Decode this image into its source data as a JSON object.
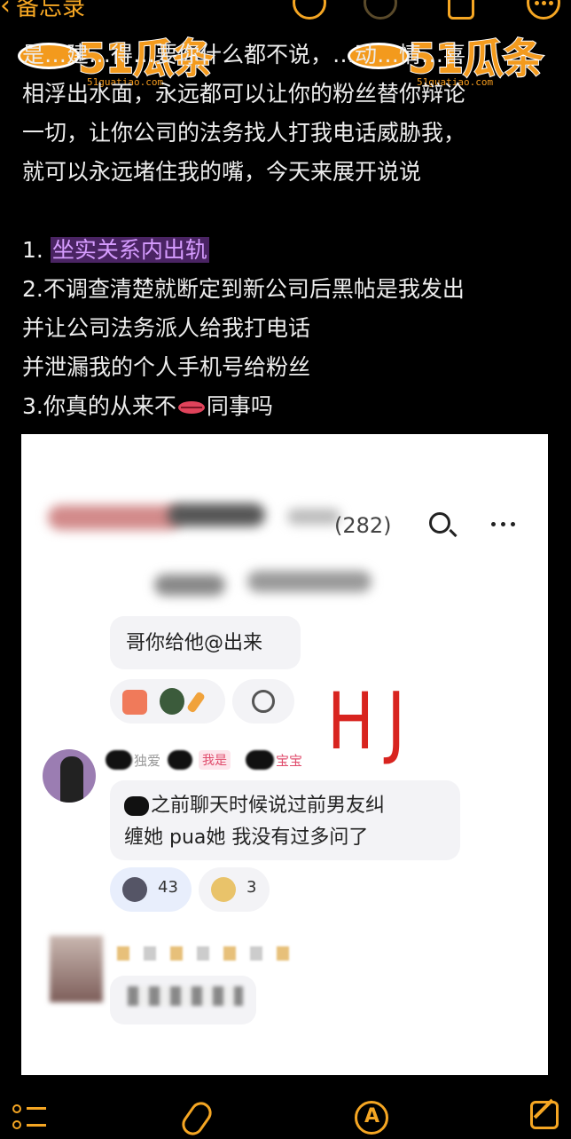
{
  "topbar": {
    "back_label": "备忘录"
  },
  "watermark": {
    "logo_text": "51瓜条",
    "url_text": "51guatiao.com"
  },
  "note": {
    "lines": [
      "是…建…得…要你什么都不说，…动…情…喜",
      "相浮出水面，永远都可以让你的粉丝替你辩论",
      "一切，让你公司的法务找人打我电话威胁我，",
      "就可以永远堵住我的嘴，今天来展开说说"
    ],
    "item1_number": "1.",
    "item1_highlight": "坐实关系内出轨",
    "item2_line1": "2.不调查清楚就断定到新公司后黑帖是我发出",
    "item2_line2": "并让公司法务派人给我打电话",
    "item2_line3": "并泄漏我的个人手机号给粉丝",
    "item3_prefix": "3.你真的从来不",
    "item3_suffix": "同事吗"
  },
  "screenshot": {
    "member_count": "(282)",
    "msg1": "哥你给他@出来",
    "annotation": "HJ",
    "user2_name_fragment": "独爱",
    "user2_tag": "我是",
    "user2_name_suffix": "宝宝",
    "msg2_line1": "之前聊天时候说过前男友纠",
    "msg2_line2": "缠她 pua她 我没有过多问了",
    "reaction1_count": "43",
    "reaction2_count": "3"
  },
  "icons": {
    "topbar": [
      "chevron-left-icon",
      "undo-icon",
      "redo-icon",
      "share-icon",
      "more-icon"
    ],
    "bottombar": [
      "checklist-icon",
      "paperclip-icon",
      "markup-icon",
      "compose-icon"
    ]
  },
  "colors": {
    "accent": "#f5a623",
    "highlight_bg": "#4a2463",
    "highlight_text": "#d69cff",
    "annotation": "#d8241f"
  }
}
